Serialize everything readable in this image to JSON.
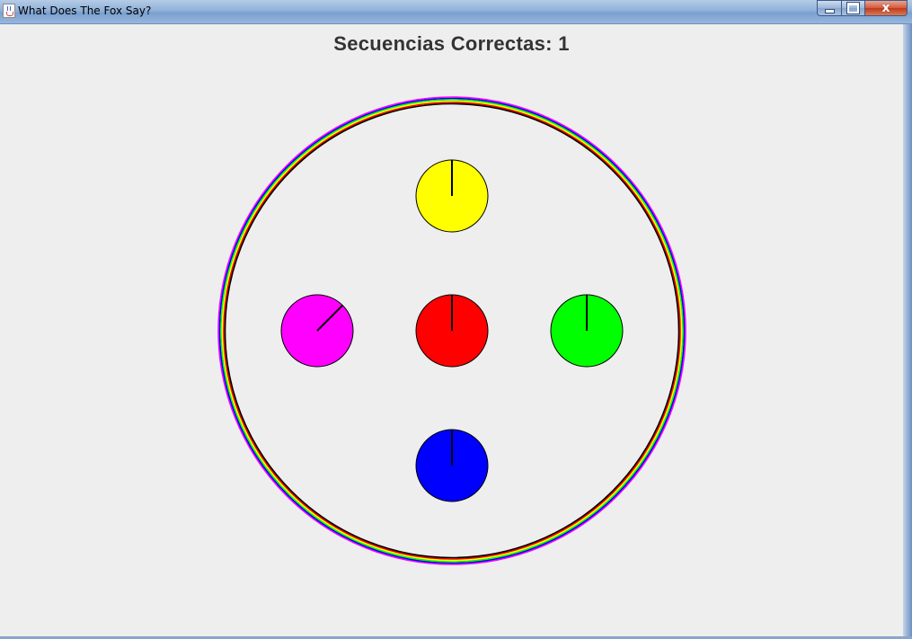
{
  "window": {
    "title": "What Does The Fox Say?",
    "icon": "java-cup-icon",
    "controls": [
      "minimize-icon",
      "maximize-icon",
      "close-icon"
    ],
    "close_glyph": "x"
  },
  "game": {
    "score_text": "Secuencias Correctas:  1",
    "ring_colors": [
      "#ff00ff",
      "#0000ff",
      "#00ff00",
      "#ffff00",
      "#ff0000",
      "#000000"
    ],
    "buttons": [
      {
        "name": "yellow",
        "color": "#ffff00",
        "hand_angle_deg": 0
      },
      {
        "name": "magenta",
        "color": "#ff00ff",
        "hand_angle_deg": 45
      },
      {
        "name": "red",
        "color": "#ff0000",
        "hand_angle_deg": 0
      },
      {
        "name": "green",
        "color": "#00ff00",
        "hand_angle_deg": 0
      },
      {
        "name": "blue",
        "color": "#0000ff",
        "hand_angle_deg": 0
      }
    ]
  }
}
